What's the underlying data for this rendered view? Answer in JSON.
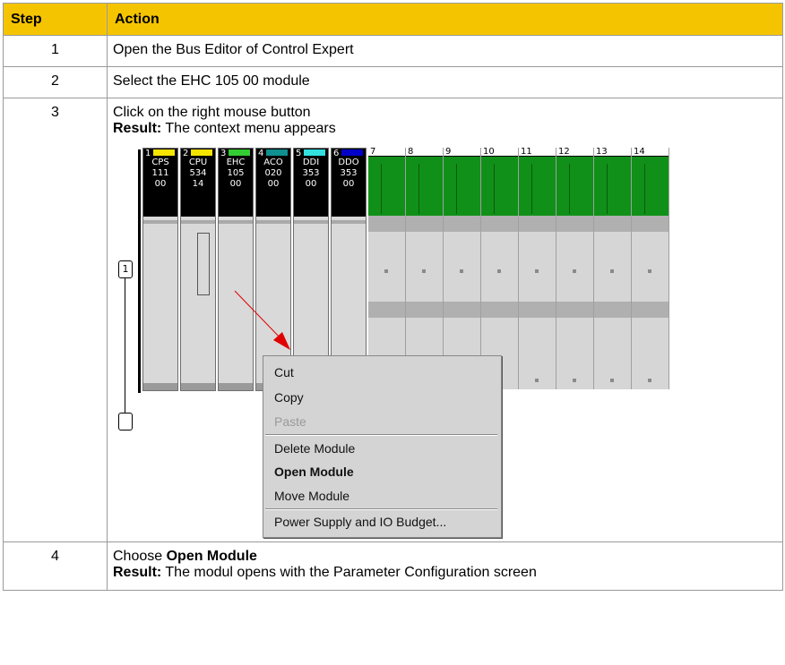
{
  "table": {
    "headers": {
      "step": "Step",
      "action": "Action"
    },
    "rows": [
      {
        "num": "1",
        "text": "Open the Bus Editor of Control Expert"
      },
      {
        "num": "2",
        "text": "Select the EHC 105 00 module"
      },
      {
        "num": "3",
        "text": "Click on the right mouse button",
        "result_label": "Result:",
        "result_text": " The context menu appears"
      },
      {
        "num": "4",
        "text_prefix": "Choose ",
        "text_bold": "Open Module",
        "result_label": "Result:",
        "result_text": " The modul opens with the Parameter Configuration screen"
      }
    ]
  },
  "figure": {
    "modules": [
      {
        "slot": "1",
        "color": "#f4e400",
        "lines": [
          "CPS",
          "111",
          "00"
        ]
      },
      {
        "slot": "2",
        "color": "#f4e400",
        "lines": [
          "CPU",
          "534",
          "14"
        ]
      },
      {
        "slot": "3",
        "color": "#33cc33",
        "lines": [
          "EHC",
          "105",
          "00"
        ]
      },
      {
        "slot": "4",
        "color": "#109090",
        "lines": [
          "ACO",
          "020",
          "00"
        ]
      },
      {
        "slot": "5",
        "color": "#33e0e0",
        "lines": [
          "DDI",
          "353",
          "00"
        ]
      },
      {
        "slot": "6",
        "color": "#0000c8",
        "lines": [
          "DDO",
          "353",
          "00"
        ]
      }
    ],
    "empty_slots": [
      "7",
      "8",
      "9",
      "10",
      "11",
      "12",
      "13",
      "14"
    ],
    "callout_top": "1",
    "callout_bottom": "",
    "context_menu": {
      "items": [
        {
          "label": "Cut",
          "state": "normal"
        },
        {
          "label": "Copy",
          "state": "normal"
        },
        {
          "label": "Paste",
          "state": "disabled"
        },
        {
          "label": "Delete Module",
          "state": "normal"
        },
        {
          "label": "Open Module",
          "state": "bold"
        },
        {
          "label": "Move Module",
          "state": "normal"
        },
        {
          "label": "Power Supply and IO Budget...",
          "state": "normal"
        }
      ]
    }
  }
}
